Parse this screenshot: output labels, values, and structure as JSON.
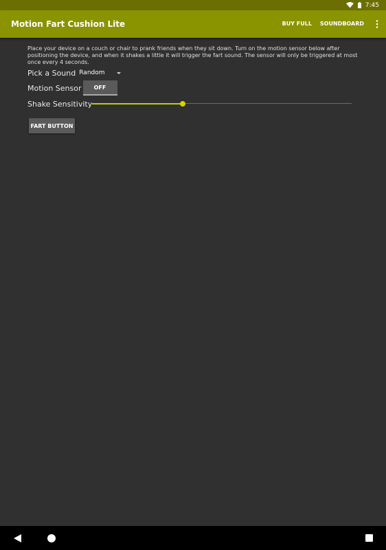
{
  "status_bar": {
    "time": "7:45",
    "icons": [
      "wifi-icon",
      "battery-icon"
    ],
    "background": "#6b6e00"
  },
  "app_bar": {
    "title": "Motion Fart Cushion Lite",
    "actions": [
      "BUY FULL",
      "SOUNDBOARD"
    ],
    "overflow_icon": "more-vert-icon",
    "background": "#8a9300"
  },
  "content": {
    "instructions": "Place your device on a couch or chair to prank friends when they sit down. Turn on the motion sensor below after positioning the device, and when it shakes a little it will trigger the fart sound. The sensor will only be triggered at most once every 4 seconds.",
    "sound": {
      "label": "Pick a Sound",
      "selected": "Random"
    },
    "motion_sensor": {
      "label": "Motion Sensor",
      "toggle_text": "OFF"
    },
    "shake_sensitivity": {
      "label": "Shake Sensitivity",
      "value_percent": 35,
      "accent": "#c8c800"
    },
    "fart_button": "FART BUTTON"
  },
  "nav_bar": {
    "icons": [
      "back-icon",
      "home-icon",
      "recents-icon"
    ]
  }
}
